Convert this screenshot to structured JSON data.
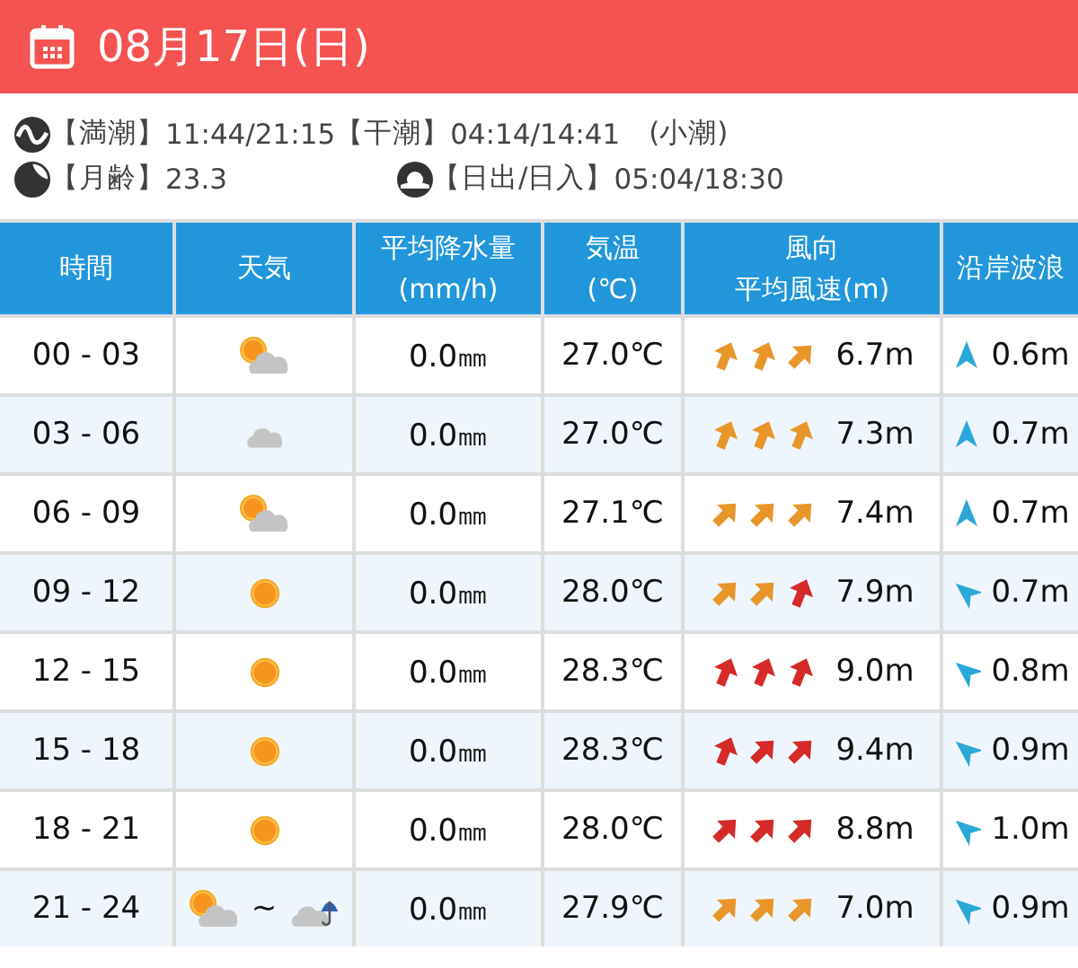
{
  "header": {
    "date": "08月17日(日)"
  },
  "info": {
    "tide": [
      {
        "label": "【満潮】",
        "value": "11:44/21:15"
      },
      {
        "label": "【干潮】",
        "value": "04:14/14:41"
      }
    ],
    "tide_type": "(小潮)",
    "moon": {
      "label": "【月齢】",
      "value": "23.3"
    },
    "sun": {
      "label": "【日出/日入】",
      "value": "05:04/18:30"
    }
  },
  "table": {
    "columns": [
      {
        "lines": [
          "時間"
        ]
      },
      {
        "lines": [
          "天気"
        ]
      },
      {
        "lines": [
          "平均降水量",
          "(mm/h)"
        ]
      },
      {
        "lines": [
          "気温",
          "(℃)"
        ]
      },
      {
        "lines": [
          "風向",
          "平均風速(m)"
        ]
      },
      {
        "lines": [
          "沿岸波浪"
        ]
      }
    ],
    "rows": [
      {
        "time": "00 - 03",
        "weather": {
          "icons": [
            {
              "kind": "partly_cloudy"
            }
          ]
        },
        "rain": "0.0㎜",
        "temp": "27.0℃",
        "wind": [
          {
            "kind": "nne",
            "color": "#e8962a"
          },
          {
            "kind": "nne",
            "color": "#e8962a"
          },
          {
            "kind": "ne",
            "color": "#e8962a"
          }
        ],
        "wind_speed": "6.7m",
        "wave_arrow": {
          "kind": "n"
        },
        "wave": "0.6m"
      },
      {
        "time": "03 - 06",
        "weather": {
          "icons": [
            {
              "kind": "cloudy"
            }
          ]
        },
        "rain": "0.0㎜",
        "temp": "27.0℃",
        "wind": [
          {
            "kind": "nne",
            "color": "#e8962a"
          },
          {
            "kind": "nne",
            "color": "#e8962a"
          },
          {
            "kind": "nne",
            "color": "#e8962a"
          }
        ],
        "wind_speed": "7.3m",
        "wave_arrow": {
          "kind": "n"
        },
        "wave": "0.7m"
      },
      {
        "time": "06 - 09",
        "weather": {
          "icons": [
            {
              "kind": "partly_cloudy"
            }
          ]
        },
        "rain": "0.0㎜",
        "temp": "27.1℃",
        "wind": [
          {
            "kind": "ne",
            "color": "#e8962a"
          },
          {
            "kind": "ne",
            "color": "#e8962a"
          },
          {
            "kind": "ne",
            "color": "#e8962a"
          }
        ],
        "wind_speed": "7.4m",
        "wave_arrow": {
          "kind": "n"
        },
        "wave": "0.7m"
      },
      {
        "time": "09 - 12",
        "weather": {
          "icons": [
            {
              "kind": "sunny"
            }
          ]
        },
        "rain": "0.0㎜",
        "temp": "28.0℃",
        "wind": [
          {
            "kind": "ne",
            "color": "#e8962a"
          },
          {
            "kind": "ne",
            "color": "#e8962a"
          },
          {
            "kind": "nne",
            "color": "#d42a2a"
          }
        ],
        "wind_speed": "7.9m",
        "wave_arrow": {
          "kind": "nw"
        },
        "wave": "0.7m"
      },
      {
        "time": "12 - 15",
        "weather": {
          "icons": [
            {
              "kind": "sunny"
            }
          ]
        },
        "rain": "0.0㎜",
        "temp": "28.3℃",
        "wind": [
          {
            "kind": "nne",
            "color": "#d42a2a"
          },
          {
            "kind": "nne",
            "color": "#d42a2a"
          },
          {
            "kind": "nne",
            "color": "#d42a2a"
          }
        ],
        "wind_speed": "9.0m",
        "wave_arrow": {
          "kind": "nw"
        },
        "wave": "0.8m"
      },
      {
        "time": "15 - 18",
        "weather": {
          "icons": [
            {
              "kind": "sunny"
            }
          ]
        },
        "rain": "0.0㎜",
        "temp": "28.3℃",
        "wind": [
          {
            "kind": "nne",
            "color": "#d42a2a"
          },
          {
            "kind": "ne",
            "color": "#d42a2a"
          },
          {
            "kind": "ne",
            "color": "#d42a2a"
          }
        ],
        "wind_speed": "9.4m",
        "wave_arrow": {
          "kind": "nw"
        },
        "wave": "0.9m"
      },
      {
        "time": "18 - 21",
        "weather": {
          "icons": [
            {
              "kind": "sunny"
            }
          ]
        },
        "rain": "0.0㎜",
        "temp": "28.0℃",
        "wind": [
          {
            "kind": "ne",
            "color": "#d42a2a"
          },
          {
            "kind": "ne",
            "color": "#d42a2a"
          },
          {
            "kind": "ne",
            "color": "#d42a2a"
          }
        ],
        "wind_speed": "8.8m",
        "wave_arrow": {
          "kind": "nw"
        },
        "wave": "1.0m"
      },
      {
        "time": "21 - 24",
        "weather": {
          "icons": [
            {
              "kind": "partly_cloudy"
            },
            {
              "kind": "rain_cloudy"
            }
          ],
          "separator": "~"
        },
        "rain": "0.0㎜",
        "temp": "27.9℃",
        "wind": [
          {
            "kind": "ne",
            "color": "#e8962a"
          },
          {
            "kind": "ne",
            "color": "#e8962a"
          },
          {
            "kind": "ne",
            "color": "#e8962a"
          }
        ],
        "wind_speed": "7.0m",
        "wave_arrow": {
          "kind": "nw"
        },
        "wave": "0.9m"
      }
    ]
  }
}
